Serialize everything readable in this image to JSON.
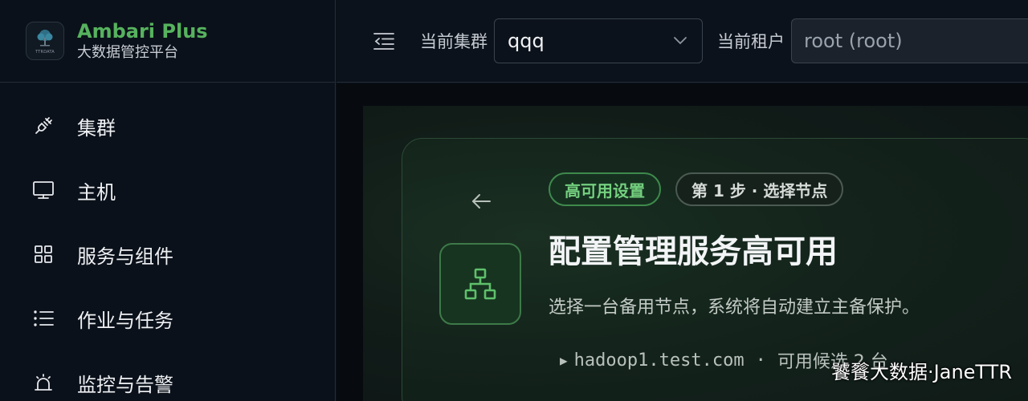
{
  "brand": {
    "name": "Ambari Plus",
    "subtitle": "大数据管控平台",
    "logo_text": "TTRDATA"
  },
  "nav": {
    "items": [
      {
        "label": "集群",
        "icon": "plug-icon"
      },
      {
        "label": "主机",
        "icon": "monitor-icon"
      },
      {
        "label": "服务与组件",
        "icon": "grid-icon"
      },
      {
        "label": "作业与任务",
        "icon": "list-icon"
      },
      {
        "label": "监控与告警",
        "icon": "alarm-icon"
      }
    ]
  },
  "topbar": {
    "cluster_label": "当前集群",
    "cluster_value": "qqq",
    "tenant_label": "当前租户",
    "tenant_value": "root (root)"
  },
  "card": {
    "chip_ha": "高可用设置",
    "chip_step": "第 1 步 · 选择节点",
    "title": "配置管理服务高可用",
    "description": "选择一台备用节点，系统将自动建立主备保护。",
    "node_host": "hadoop1.test.com",
    "node_separator": "·",
    "node_candidates": "可用候选 2 台"
  },
  "watermark": "饕餮大数据·JaneTTR",
  "colors": {
    "accent_green": "#56b25e",
    "chip_green": "#74d07f",
    "background": "#0b1119"
  }
}
